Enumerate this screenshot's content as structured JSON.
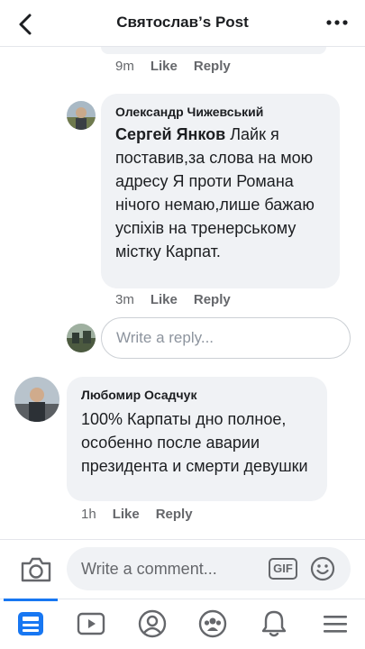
{
  "header": {
    "title": "Святослав’s Post",
    "back_icon": "back-chevron-icon",
    "more_icon": "more-dots-icon"
  },
  "previous_comment": {
    "time": "9m",
    "like_label": "Like",
    "reply_label": "Reply"
  },
  "reply_comment": {
    "author": "Олександр Чижевський",
    "mention": "Сергей Янков",
    "text_after_mention": " Лайк я поставив,за слова на мою адресу Я проти Романа нічого немаю,лише бажаю успіхів на тренерському містку Карпат.",
    "time": "3m",
    "like_label": "Like",
    "reply_label": "Reply"
  },
  "reply_input": {
    "placeholder": "Write a reply..."
  },
  "comment_2": {
    "author": "Любомир Осадчук",
    "text": "100% Карпаты дно полное, особенно после аварии президента и смерти девушки",
    "time": "1h",
    "like_label": "Like",
    "reply_label": "Reply"
  },
  "composer": {
    "placeholder": "Write a comment...",
    "gif_label": "GIF",
    "camera_icon": "camera-icon",
    "emoji_icon": "emoji-icon"
  },
  "tabbar": {
    "items": [
      "feed-icon",
      "watch-icon",
      "profile-icon",
      "groups-icon",
      "notifications-icon",
      "menu-icon"
    ],
    "active_index": 0
  },
  "colors": {
    "accent": "#1877f2",
    "bubble": "#f0f2f5",
    "secondary_text": "#65676b"
  }
}
